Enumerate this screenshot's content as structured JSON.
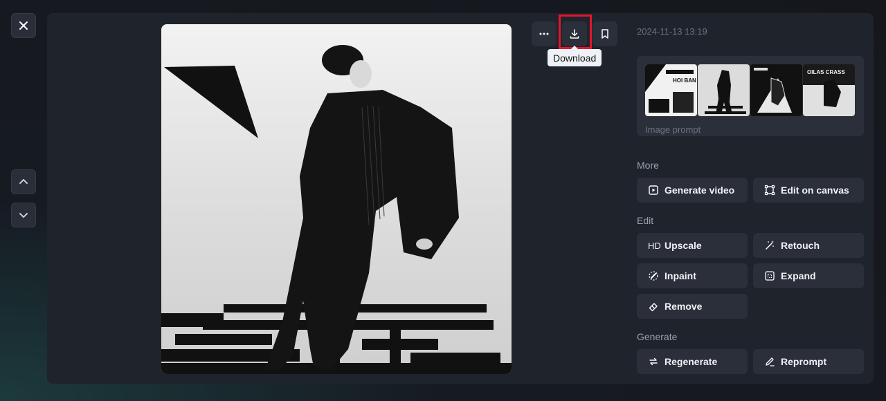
{
  "close": {
    "icon": "close-icon"
  },
  "nav": {
    "prev_icon": "chevron-up-icon",
    "next_icon": "chevron-down-icon"
  },
  "toolbar": {
    "more_icon": "more-icon",
    "download_icon": "download-icon",
    "bookmark_icon": "bookmark-icon",
    "tooltip": "Download"
  },
  "detail": {
    "timestamp": "2024-11-13 13:19",
    "image_prompt_label": "Image prompt",
    "thumb_texts": [
      "HOI BAN",
      "",
      "",
      "OILAS CRASS"
    ]
  },
  "sections": {
    "more": "More",
    "edit": "Edit",
    "generate": "Generate"
  },
  "actions": {
    "generate_video": "Generate video",
    "edit_on_canvas": "Edit on canvas",
    "upscale_prefix": "HD",
    "upscale": "Upscale",
    "retouch": "Retouch",
    "inpaint": "Inpaint",
    "expand": "Expand",
    "remove": "Remove",
    "regenerate": "Regenerate",
    "reprompt": "Reprompt"
  }
}
